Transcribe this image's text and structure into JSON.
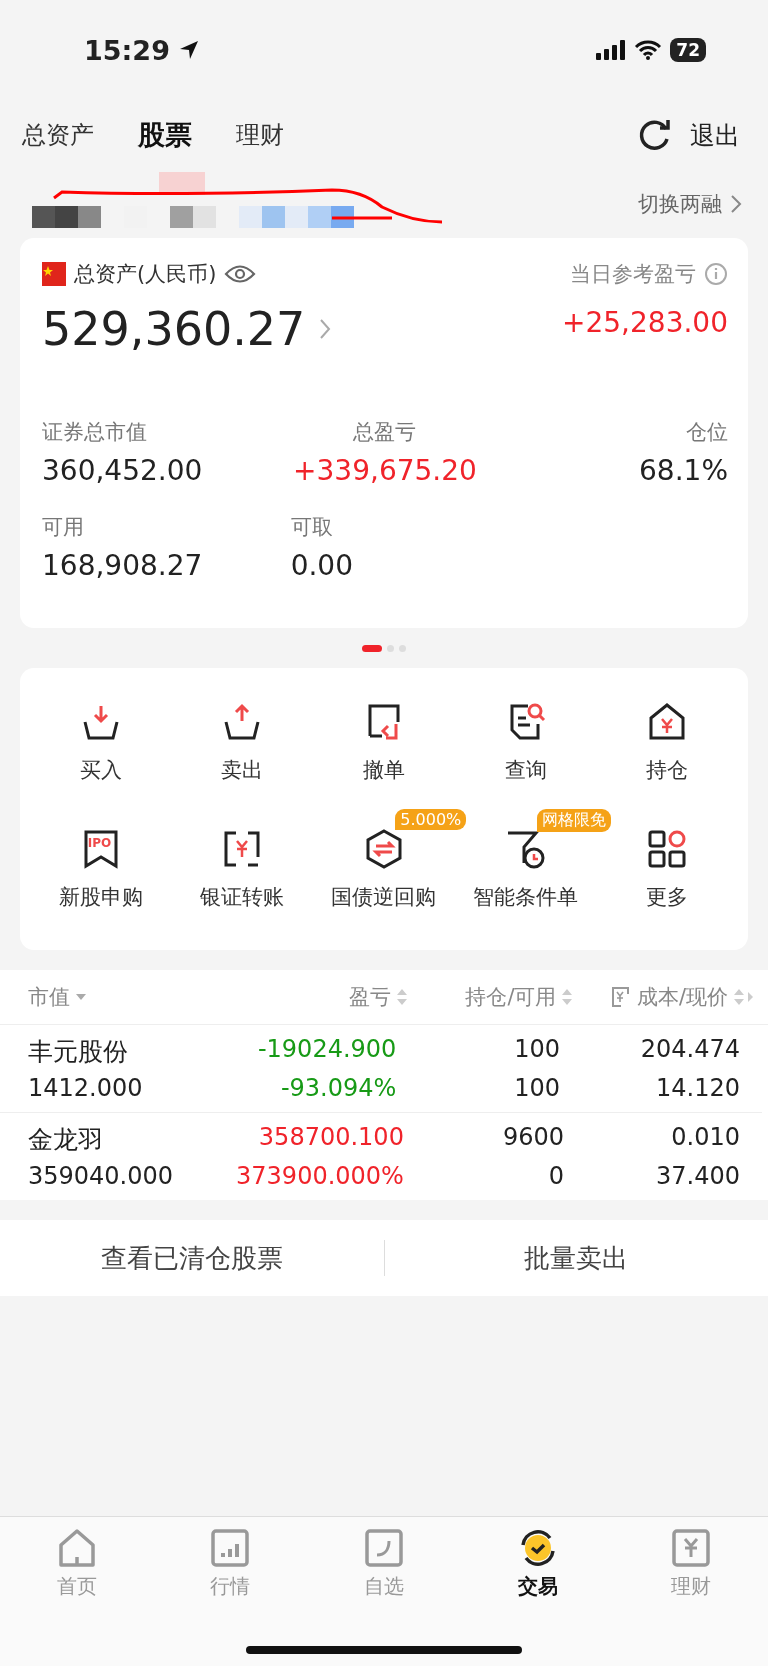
{
  "status_bar": {
    "time": "15:29",
    "battery": "72"
  },
  "header_tabs": [
    {
      "label": "总资产",
      "selected": false
    },
    {
      "label": "股票",
      "selected": true
    },
    {
      "label": "理财",
      "selected": false
    }
  ],
  "header_action": "退出",
  "account": {
    "switch_label": "切换两融"
  },
  "asset_card": {
    "title": "总资产(人民币)",
    "daily_label": "当日参考盈亏",
    "total": "529,360.27",
    "daily_value": "+25,283.00",
    "stats": [
      {
        "label": "证券总市值",
        "value": "360,452.00",
        "color": "#222222"
      },
      {
        "label": "总盈亏",
        "value": "+339,675.20",
        "color": "#f0232a"
      },
      {
        "label": "仓位",
        "value": "68.1%",
        "color": "#222222"
      },
      {
        "label": "可用",
        "value": "168,908.27",
        "color": "#222222"
      },
      {
        "label": "可取",
        "value": "0.00",
        "color": "#222222"
      }
    ]
  },
  "pager": [
    {
      "selected": true
    },
    {
      "selected": false
    },
    {
      "selected": false
    }
  ],
  "actions": [
    {
      "kind": "buy",
      "label": "买入"
    },
    {
      "kind": "sell",
      "label": "卖出"
    },
    {
      "kind": "cancel",
      "label": "撤单"
    },
    {
      "kind": "query",
      "label": "查询"
    },
    {
      "kind": "position",
      "label": "持仓"
    },
    {
      "kind": "ipo",
      "label": "新股申购",
      "icon_text": "IPO"
    },
    {
      "kind": "transfer",
      "label": "银证转账"
    },
    {
      "kind": "repo",
      "label": "国债逆回购",
      "badge": "5.000%"
    },
    {
      "kind": "condition",
      "label": "智能条件单",
      "badge": "网格限免"
    },
    {
      "kind": "more",
      "label": "更多"
    }
  ],
  "table": {
    "columns": [
      "市值",
      "盈亏",
      "持仓/可用",
      "成本/现价"
    ],
    "rows": [
      {
        "name": "丰元股份",
        "market_value": "1412.000",
        "pnl": "-19024.900",
        "pnl_pct": "-93.094%",
        "color": "#179a16",
        "holding": "100",
        "available": "100",
        "cost": "204.474",
        "price": "14.120"
      },
      {
        "name": "金龙羽",
        "market_value": "359040.000",
        "pnl": "358700.100",
        "pnl_pct": "373900.000%",
        "color": "#f0232a",
        "holding": "9600",
        "available": "0",
        "cost": "0.010",
        "price": "37.400"
      }
    ]
  },
  "footer_buttons": [
    "查看已清仓股票",
    "批量卖出"
  ],
  "bottom_nav": [
    {
      "kind": "home",
      "label": "首页",
      "selected": false
    },
    {
      "kind": "market",
      "label": "行情",
      "selected": false
    },
    {
      "kind": "watch",
      "label": "自选",
      "selected": false
    },
    {
      "kind": "trade",
      "label": "交易",
      "selected": true
    },
    {
      "kind": "wealth",
      "label": "理财",
      "selected": false
    }
  ]
}
